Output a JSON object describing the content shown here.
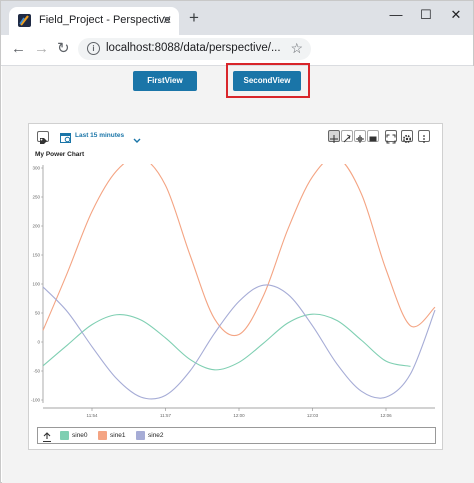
{
  "browser": {
    "tab_title": "Field_Project - Perspective",
    "tab_close": "✕",
    "new_tab": "+",
    "url": "localhost:8088/data/perspective/...",
    "win_minimize": "—",
    "win_maximize": "☐",
    "win_close": "✕",
    "back": "←",
    "forward": "→",
    "reload": "↻",
    "star": "☆"
  },
  "views": {
    "first_label": "FirstView",
    "second_label": "SecondView"
  },
  "chart_panel": {
    "time_range_label": "Last 15 minutes",
    "chart_title": "My Power Chart"
  },
  "colors": {
    "sine0": "#7fcfb2",
    "sine1": "#f4a483",
    "sine2": "#a6acd6",
    "button": "#1a75a8",
    "highlight": "#d9262b"
  },
  "chart_data": {
    "type": "line",
    "title": "My Power Chart",
    "x_tick_labels": [
      "11:54",
      "11:57",
      "12:00",
      "12:03",
      "12:06"
    ],
    "y_tick_labels": [
      "300",
      "250",
      "200",
      "150",
      "100",
      "50",
      "0",
      "-50",
      "-100"
    ],
    "ylim": [
      -100,
      300
    ],
    "x_range_minutes": [
      0,
      15
    ],
    "grid": false,
    "legend_position": "bottom",
    "series": [
      {
        "name": "sine0",
        "color": "#7fcfb2",
        "points": [
          [
            0,
            -41
          ],
          [
            1,
            -5
          ],
          [
            2,
            30
          ],
          [
            3,
            47
          ],
          [
            4,
            38
          ],
          [
            5,
            7
          ],
          [
            6,
            -30
          ],
          [
            7,
            -48
          ],
          [
            8,
            -35
          ],
          [
            9,
            -2
          ],
          [
            10,
            33
          ],
          [
            11,
            48
          ],
          [
            12,
            37
          ],
          [
            13,
            3
          ],
          [
            14,
            -33
          ],
          [
            15,
            -42
          ]
        ]
      },
      {
        "name": "sine1",
        "color": "#f4a483",
        "points": [
          [
            0,
            20
          ],
          [
            1,
            120
          ],
          [
            2,
            225
          ],
          [
            3,
            295
          ],
          [
            4,
            318
          ],
          [
            5,
            270
          ],
          [
            6,
            150
          ],
          [
            7,
            40
          ],
          [
            8,
            13
          ],
          [
            9,
            80
          ],
          [
            10,
            195
          ],
          [
            11,
            285
          ],
          [
            12,
            318
          ],
          [
            13,
            255
          ],
          [
            14,
            125
          ],
          [
            15,
            28
          ],
          [
            16,
            60
          ]
        ]
      },
      {
        "name": "sine2",
        "color": "#a6acd6",
        "points": [
          [
            0,
            95
          ],
          [
            1,
            52
          ],
          [
            2,
            -8
          ],
          [
            3,
            -63
          ],
          [
            4,
            -95
          ],
          [
            5,
            -92
          ],
          [
            6,
            -50
          ],
          [
            7,
            15
          ],
          [
            8,
            70
          ],
          [
            9,
            98
          ],
          [
            10,
            82
          ],
          [
            11,
            28
          ],
          [
            12,
            -38
          ],
          [
            13,
            -85
          ],
          [
            14,
            -95
          ],
          [
            15,
            -55
          ],
          [
            16,
            55
          ]
        ]
      }
    ]
  }
}
